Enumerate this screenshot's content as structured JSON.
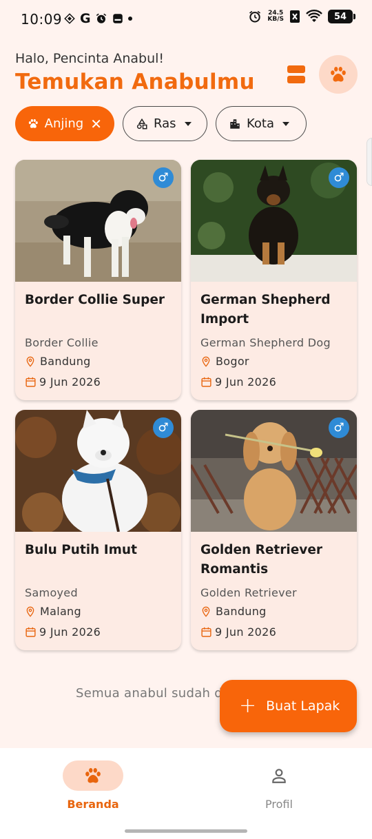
{
  "status_bar": {
    "time": "10:09",
    "left_icons": [
      "dropbox-icon",
      "google-icon",
      "alarm-icon",
      "message-icon",
      "dot-icon"
    ],
    "net_speed_value": "24.5",
    "net_speed_unit": "KB/S",
    "battery": "54"
  },
  "header": {
    "greeting": "Halo, Pencinta Anabul!",
    "title": "Temukan Anabulmu",
    "layout_icon": "view-agenda-icon",
    "paw_icon": "paw-icon"
  },
  "filters": {
    "active": {
      "label": "Anjing",
      "icon": "paw-icon",
      "clear_icon": "close-icon"
    },
    "breed": {
      "label": "Ras",
      "icon": "category-icon"
    },
    "city": {
      "label": "Kota",
      "icon": "city-icon"
    }
  },
  "listings": [
    {
      "name": "Border Collie Super",
      "breed": "Border Collie",
      "location": "Bandung",
      "date": "9 Jun 2026",
      "gender": "♂"
    },
    {
      "name": "German Shepherd Import",
      "breed": "German Shepherd Dog",
      "location": "Bogor",
      "date": "9 Jun 2026",
      "gender": "♂"
    },
    {
      "name": "Bulu Putih Imut",
      "breed": "Samoyed",
      "location": "Malang",
      "date": "9 Jun 2026",
      "gender": "♂"
    },
    {
      "name": "Golden Retriever Romantis",
      "breed": "Golden Retriever",
      "location": "Bandung",
      "date": "9 Jun 2026",
      "gender": "♂"
    }
  ],
  "end_message": "Semua anabul sudah d",
  "fab": {
    "label": "Buat Lapak",
    "icon": "plus-icon"
  },
  "bottom_nav": {
    "home": {
      "label": "Beranda",
      "icon": "paw-icon"
    },
    "profile": {
      "label": "Profil",
      "icon": "person-icon"
    }
  },
  "colors": {
    "accent": "#f8650a",
    "background": "#fff3ef",
    "card": "#fdebe4",
    "gender_badge": "#2f8bd6"
  }
}
